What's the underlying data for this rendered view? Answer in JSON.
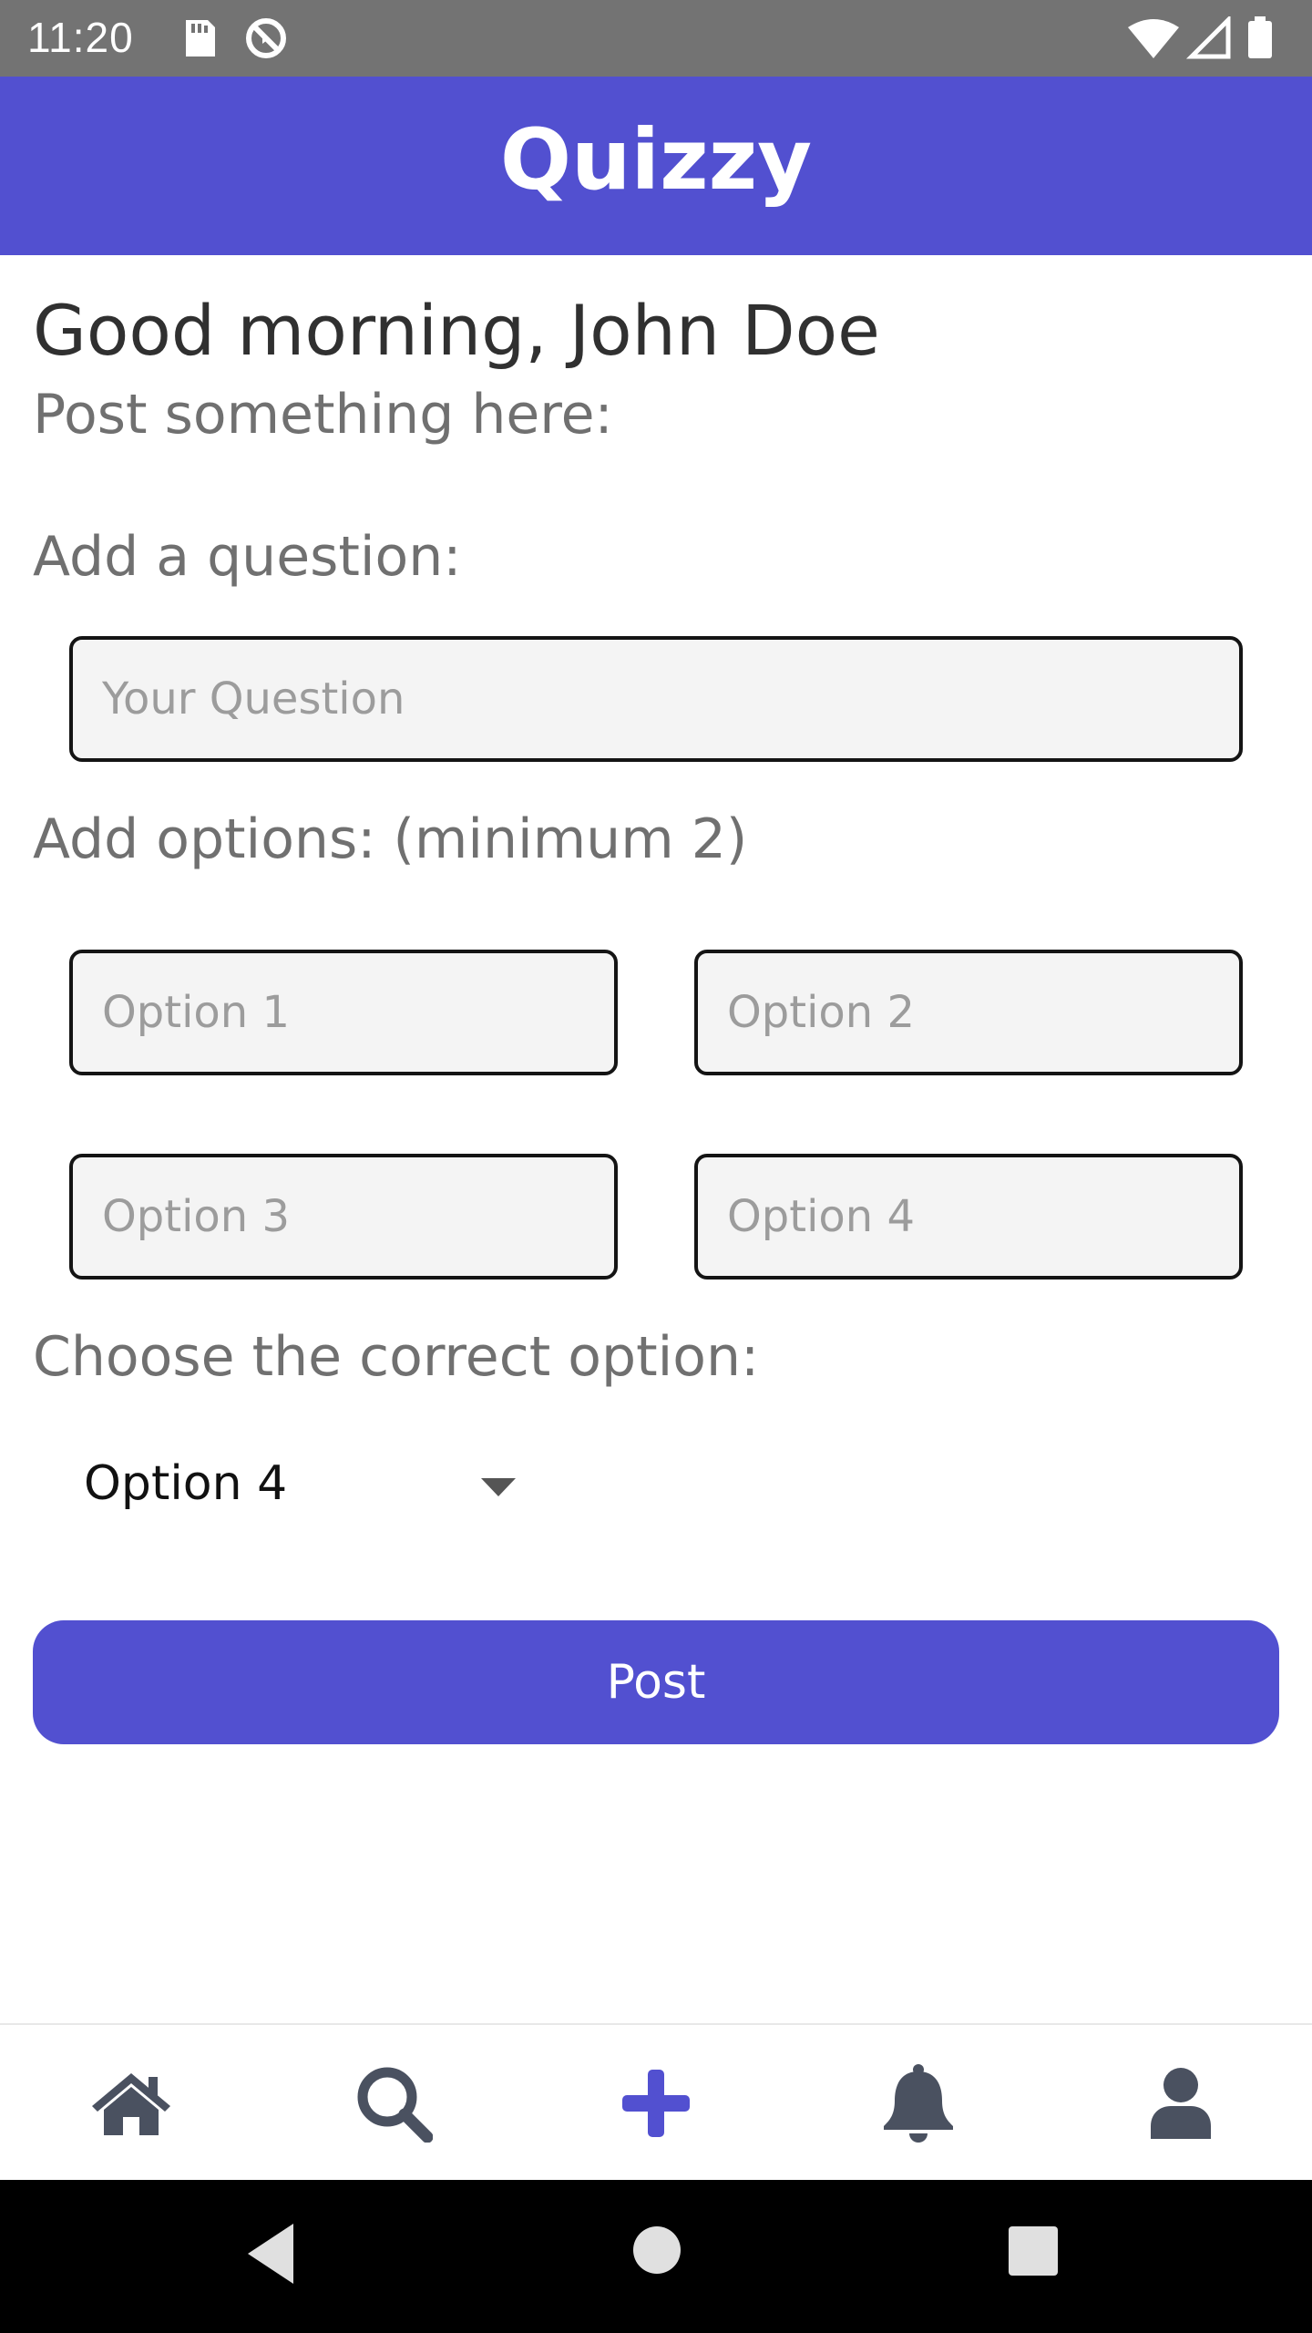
{
  "status_bar": {
    "time": "11:20",
    "left_icons": [
      "sd-card-icon",
      "no-sync-icon"
    ],
    "right_icons": [
      "wifi-icon",
      "cell-signal-icon",
      "battery-icon"
    ]
  },
  "app_bar": {
    "title": "Quizzy"
  },
  "greeting": "Good morning, John Doe",
  "subtitle": "Post something here:",
  "question": {
    "label": "Add a question:",
    "placeholder": "Your Question",
    "value": ""
  },
  "options": {
    "label": "Add options: (minimum 2)",
    "fields": [
      {
        "placeholder": "Option 1",
        "value": ""
      },
      {
        "placeholder": "Option 2",
        "value": ""
      },
      {
        "placeholder": "Option 3",
        "value": ""
      },
      {
        "placeholder": "Option 4",
        "value": ""
      }
    ]
  },
  "correct_option": {
    "label": "Choose the correct option:",
    "selected": "Option 4"
  },
  "post_button": {
    "label": "Post"
  },
  "bottom_nav": {
    "items": [
      {
        "icon": "home-icon",
        "active": false
      },
      {
        "icon": "search-icon",
        "active": false
      },
      {
        "icon": "plus-icon",
        "active": true
      },
      {
        "icon": "bell-icon",
        "active": false
      },
      {
        "icon": "user-icon",
        "active": false
      }
    ]
  },
  "colors": {
    "primary": "#5250d0",
    "status_bar": "#737373",
    "nav_icon": "#4a5160",
    "text_dark": "#303030",
    "text_muted": "#707070"
  }
}
